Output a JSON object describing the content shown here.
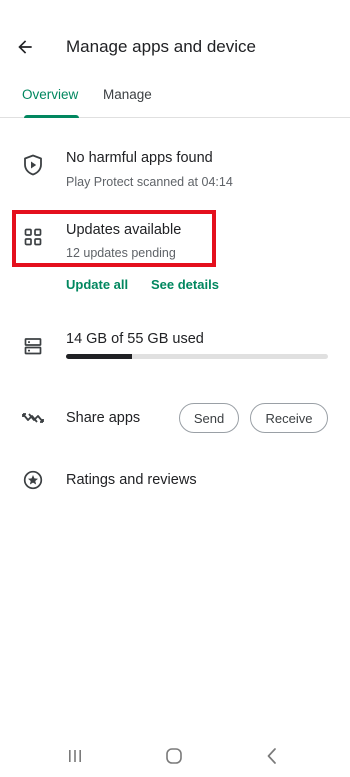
{
  "header": {
    "title": "Manage apps and device",
    "back_icon": "arrow-back-icon"
  },
  "tabs": [
    {
      "label": "Overview",
      "active": true
    },
    {
      "label": "Manage",
      "active": false
    }
  ],
  "accent_color": "#01875f",
  "highlight_color": "#e4101d",
  "protect": {
    "icon": "play-protect-icon",
    "title": "No harmful apps found",
    "subtitle": "Play Protect scanned at 04:14"
  },
  "updates": {
    "icon": "apps-grid-icon",
    "title": "Updates available",
    "subtitle": "12 updates pending",
    "update_all_label": "Update all",
    "see_details_label": "See details"
  },
  "storage": {
    "icon": "storage-icon",
    "label": "14 GB of 55 GB used",
    "used_fraction": 0.25
  },
  "share": {
    "icon": "share-apps-icon",
    "title": "Share apps",
    "send_label": "Send",
    "receive_label": "Receive"
  },
  "ratings": {
    "icon": "star-circle-icon",
    "title": "Ratings and reviews"
  },
  "system_nav": {
    "recents_icon": "recents-icon",
    "home_icon": "home-icon",
    "back_icon": "nav-back-icon"
  }
}
